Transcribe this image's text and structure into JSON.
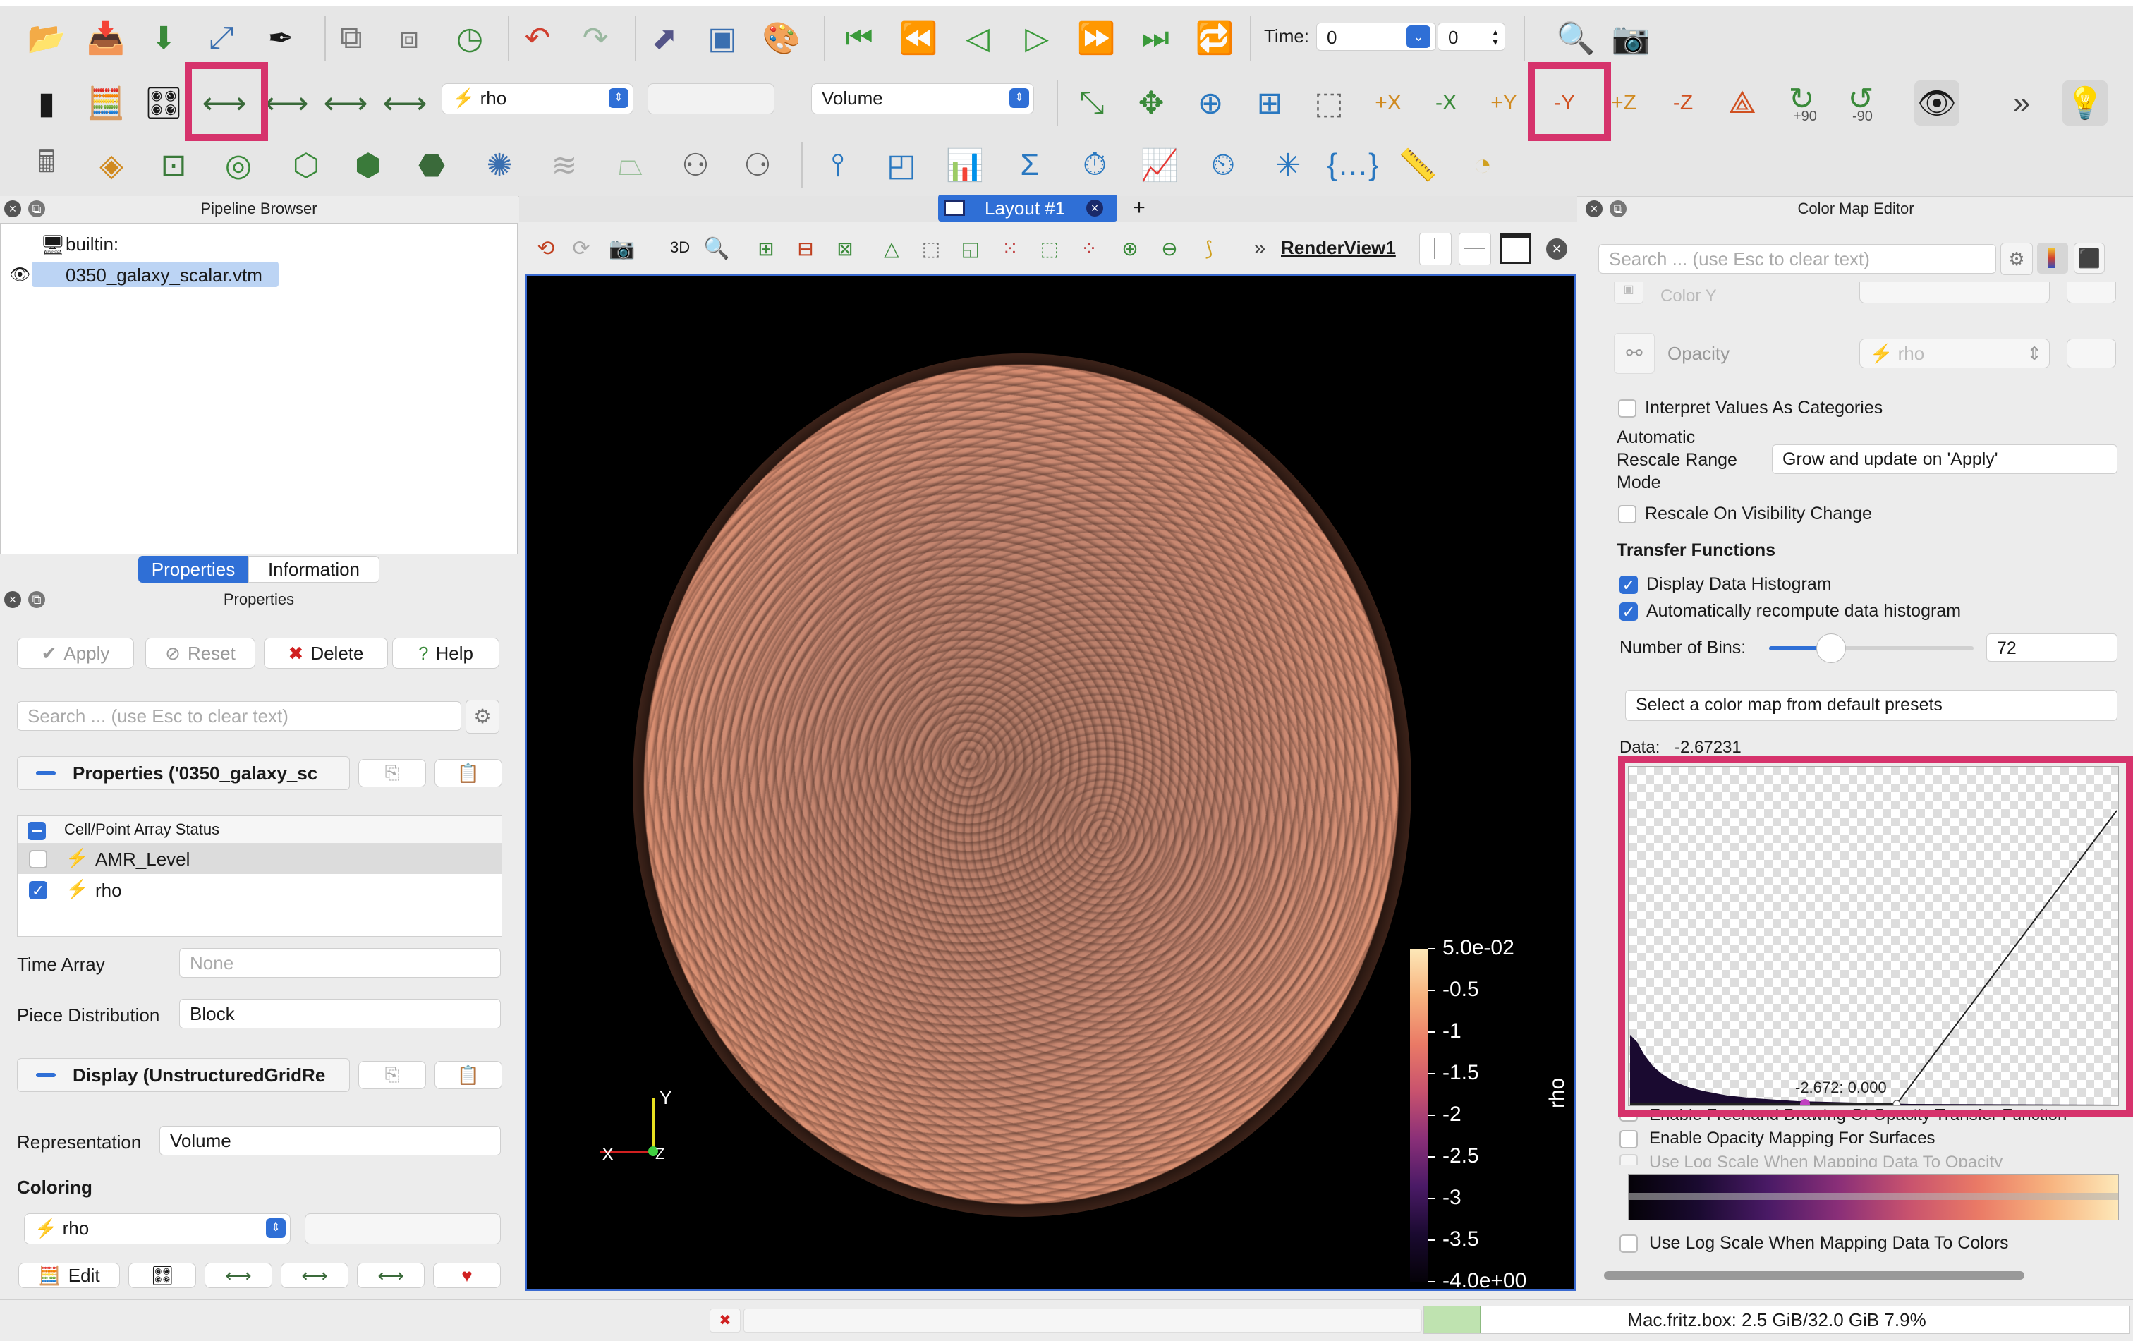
{
  "toolbar": {
    "time_label": "Time:",
    "time_value": "0",
    "time_index": "0",
    "array_select": "rho",
    "representation_select": "Volume",
    "rotate_plus": "+90",
    "rotate_minus": "-90"
  },
  "pipeline": {
    "title": "Pipeline Browser",
    "builtin": "builtin:",
    "file": "0350_galaxy_scalar.vtm"
  },
  "layout": {
    "tab": "Layout #1",
    "add": "+",
    "view_name": "RenderView1",
    "mode_3d": "3D"
  },
  "props_tabs": {
    "properties": "Properties",
    "information": "Information"
  },
  "properties": {
    "title": "Properties",
    "apply": "Apply",
    "reset": "Reset",
    "delete": "Delete",
    "help": "Help",
    "search_placeholder": "Search ... (use Esc to clear text)",
    "section_props": "Properties ('0350_galaxy_sc",
    "array_status_header": "Cell/Point Array Status",
    "arrays": [
      {
        "name": "AMR_Level",
        "checked": false
      },
      {
        "name": "rho",
        "checked": true
      }
    ],
    "time_array_label": "Time Array",
    "time_array_value": "None",
    "piece_dist_label": "Piece Distribution",
    "piece_dist_value": "Block",
    "section_display": "Display (UnstructuredGridRe",
    "representation_label": "Representation",
    "representation_value": "Volume",
    "coloring_label": "Coloring",
    "coloring_value": "rho",
    "edit_label": "Edit"
  },
  "colorbar": {
    "title": "rho",
    "ticks": [
      "5.0e-02",
      "-0.5",
      "-1",
      "-1.5",
      "-2",
      "-2.5",
      "-3",
      "-3.5",
      "-4.0e+00"
    ]
  },
  "axes": {
    "y": "Y",
    "x": "X",
    "z": "Z"
  },
  "cme": {
    "title": "Color Map Editor",
    "search_placeholder": "Search ... (use Esc to clear text)",
    "color_y_label": "Color Y",
    "opacity_label": "Opacity",
    "opacity_value": "rho",
    "interpret_categories": "Interpret Values As Categories",
    "auto_rescale_label_1": "Automatic",
    "auto_rescale_label_2": "Rescale Range",
    "auto_rescale_label_3": "Mode",
    "auto_rescale_value": "Grow and update on 'Apply'",
    "rescale_visibility": "Rescale On Visibility Change",
    "transfer_functions": "Transfer Functions",
    "display_histogram": "Display Data Histogram",
    "auto_recompute": "Automatically recompute data histogram",
    "bins_label": "Number of Bins:",
    "bins_value": "72",
    "bins_slider": 0.3,
    "presets_button": "Select a color map from default presets",
    "data_label": "Data:",
    "data_value": "-2.67231",
    "point_tooltip": "-2.672: 0.000",
    "freehand": "Enable Freehand Drawing Of Opacity Transfer Function",
    "opacity_surfaces": "Enable Opacity Mapping For Surfaces",
    "log_opacity": "Use Log Scale When Mapping Data To Opacity",
    "log_colors": "Use Log Scale When Mapping Data To Colors"
  },
  "status": {
    "memory": "Mac.fritz.box: 2.5 GiB/32.0 GiB 7.9%",
    "memory_fraction": 0.079
  },
  "colors": {
    "highlight": "#d6336c",
    "accent": "#2f6fd6"
  }
}
